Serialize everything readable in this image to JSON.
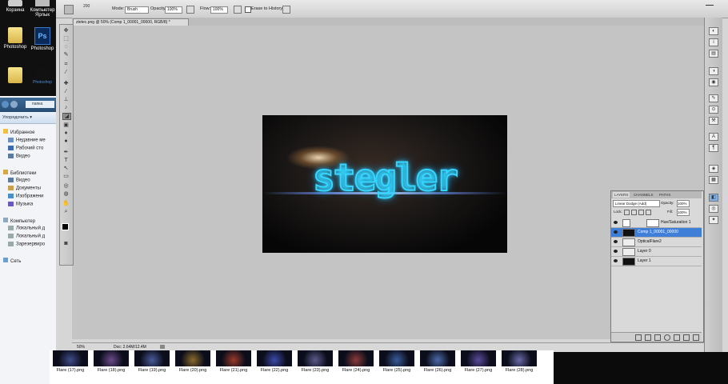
{
  "desktop": {
    "icons": [
      {
        "label": "Корзина"
      },
      {
        "label": "Компьютер Ярлык"
      },
      {
        "label": "Photoshop"
      },
      {
        "label": "Photoshop"
      },
      {
        "label": "Photoshop"
      }
    ]
  },
  "explorer": {
    "path": "папка",
    "organize": "Упорядочить ▾",
    "favorites_head": "Избранное",
    "favorites": [
      "Недавние ме",
      "Рабочий сто",
      "Видео"
    ],
    "libraries_head": "Библиотеки",
    "libraries": [
      "Видео",
      "Документы",
      "Изображени",
      "Музыка"
    ],
    "computer_head": "Компьютер",
    "computer": [
      "Локальный д",
      "Локальный д",
      "Зарезервиро"
    ],
    "network": "Сеть"
  },
  "photoshop": {
    "options": {
      "mode_label": "Mode:",
      "mode_value": "Brush",
      "opacity_label": "Opacity:",
      "opacity_value": "100%",
      "flow_label": "Flow:",
      "flow_value": "100%",
      "erase_label": "Erase to History",
      "brush_size": "200"
    },
    "doc_tab": "ztetec.png @ 50% (Comp 1_00001_00000, RGB/8) *",
    "artwork_text": "stegler",
    "status_zoom": "50%",
    "status_doc": "Doc: 2.64M/12.4M",
    "layers_panel": {
      "tabs": [
        "LAYERS",
        "CHANNELS",
        "PATHS"
      ],
      "blend_mode": "Linear Dodge (Add)",
      "opacity_label": "Opacity:",
      "opacity_value": "100%",
      "lock_label": "Lock:",
      "fill_label": "Fill:",
      "fill_value": "100%",
      "layers": [
        {
          "name": "Hue/Saturation 1",
          "selected": false
        },
        {
          "name": "Comp 1_00001_00000",
          "selected": true
        },
        {
          "name": "OpticalFlare2",
          "selected": false
        },
        {
          "name": "Layer 0",
          "selected": false
        },
        {
          "name": "Layer 1",
          "selected": false
        }
      ]
    }
  },
  "thumbnails": [
    "Flare (17).png",
    "Flare (18).png",
    "Flare (19).png",
    "Flare (20).png",
    "Flare (21).png",
    "Flare (22).png",
    "Flare (23).png",
    "Flare (24).png",
    "Flare (25).png",
    "Flare (26).png",
    "Flare (27).png",
    "Flare (28).png"
  ],
  "colors": {
    "selection": "#3f7fd8",
    "glow": "#35d6ff",
    "desktop_bg": "#0b0b0b"
  }
}
